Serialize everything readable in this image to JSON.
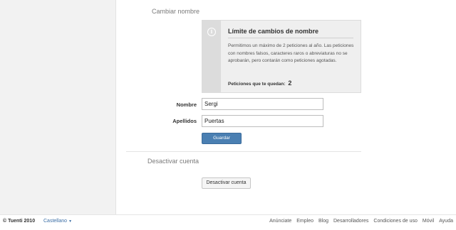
{
  "sections": {
    "change_name": "Cambiar nombre",
    "deactivate": "Desactivar cuenta"
  },
  "info_box": {
    "icon": "info-icon",
    "title": "Límite de cambios de nombre",
    "description": "Permitimos un máximo de 2 peticiones al año. Las peticiones con nombres falsos, caracteres raros o abreviaturas no se aprobarán, pero contarán como peticiones agotadas.",
    "remaining_label": "Peticiones que te quedan:",
    "remaining_count": "2"
  },
  "form": {
    "nombre_label": "Nombre",
    "nombre_value": "Sergi",
    "apellidos_label": "Apellidos",
    "apellidos_value": "Puertas",
    "save_label": "Guardar"
  },
  "deactivate_button": "Desactivar cuenta",
  "footer": {
    "copyright": "© Tuenti 2010",
    "language": "Castellano",
    "links": [
      "Anúnciate",
      "Empleo",
      "Blog",
      "Desarrolladores",
      "Condiciones de uso",
      "Móvil",
      "Ayuda"
    ]
  },
  "colors": {
    "accent": "#4a7fb2",
    "link": "#3b6ea5"
  }
}
